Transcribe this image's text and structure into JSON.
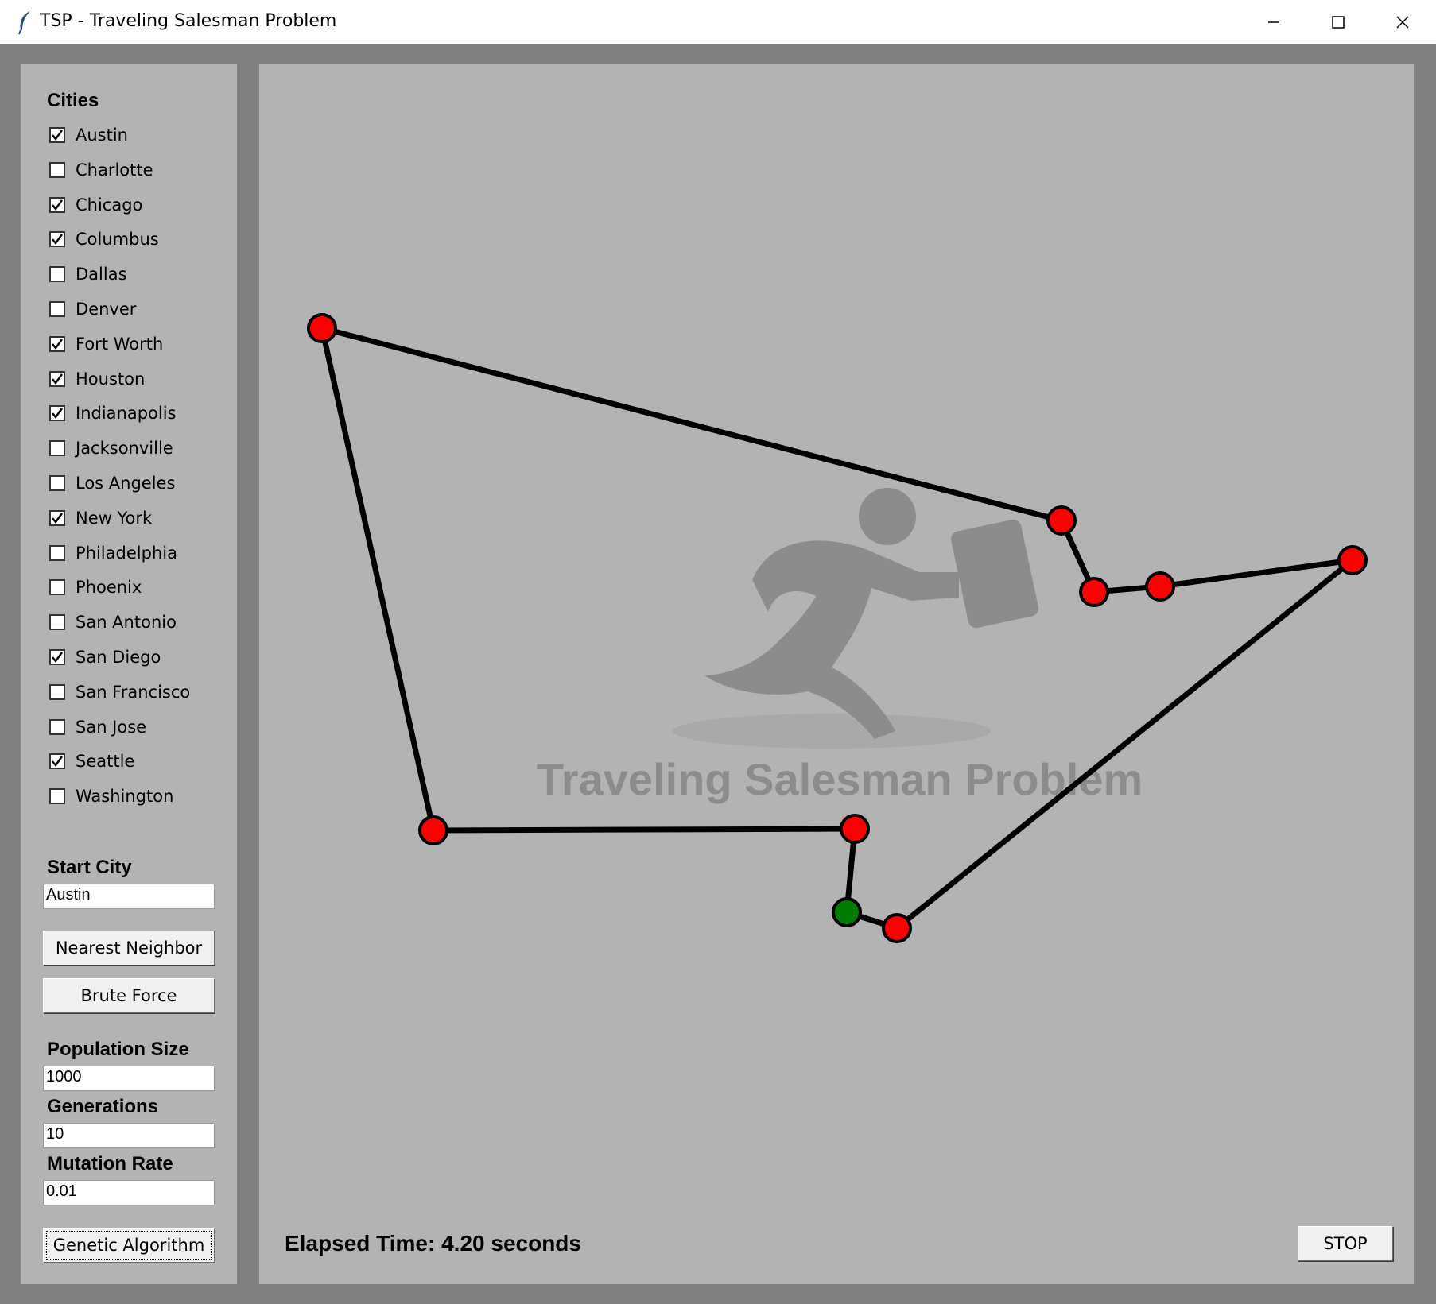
{
  "window": {
    "title": "TSP - Traveling Salesman Problem",
    "minimize_icon": "minimize-icon",
    "maximize_icon": "maximize-icon",
    "close_icon": "close-icon",
    "app_icon": "feather-icon"
  },
  "sidebar": {
    "cities_heading": "Cities",
    "cities": [
      {
        "label": "Austin",
        "checked": true
      },
      {
        "label": "Charlotte",
        "checked": false
      },
      {
        "label": "Chicago",
        "checked": true
      },
      {
        "label": "Columbus",
        "checked": true
      },
      {
        "label": "Dallas",
        "checked": false
      },
      {
        "label": "Denver",
        "checked": false
      },
      {
        "label": "Fort Worth",
        "checked": true
      },
      {
        "label": "Houston",
        "checked": true
      },
      {
        "label": "Indianapolis",
        "checked": true
      },
      {
        "label": "Jacksonville",
        "checked": false
      },
      {
        "label": "Los Angeles",
        "checked": false
      },
      {
        "label": "New York",
        "checked": true
      },
      {
        "label": "Philadelphia",
        "checked": false
      },
      {
        "label": "Phoenix",
        "checked": false
      },
      {
        "label": "San Antonio",
        "checked": false
      },
      {
        "label": "San Diego",
        "checked": true
      },
      {
        "label": "San Francisco",
        "checked": false
      },
      {
        "label": "San Jose",
        "checked": false
      },
      {
        "label": "Seattle",
        "checked": true
      },
      {
        "label": "Washington",
        "checked": false
      }
    ],
    "start_city_heading": "Start City",
    "start_city_value": "Austin",
    "nearest_neighbor_label": "Nearest Neighbor",
    "brute_force_label": "Brute Force",
    "population_heading": "Population Size",
    "population_value": "1000",
    "generations_heading": "Generations",
    "generations_value": "10",
    "mutation_heading": "Mutation Rate",
    "mutation_value": "0.01",
    "genetic_label": "Genetic Algorithm"
  },
  "canvas": {
    "watermark_text": "Traveling Salesman Problem",
    "watermark_icon": "running-salesman-icon",
    "elapsed_text": "Elapsed Time: 4.20 seconds",
    "stop_label": "STOP",
    "colors": {
      "node": "#ff0000",
      "start_node": "#007a00",
      "route": "#000000",
      "background": "#b3b3b3",
      "watermark": "#8c8c8c"
    }
  }
}
